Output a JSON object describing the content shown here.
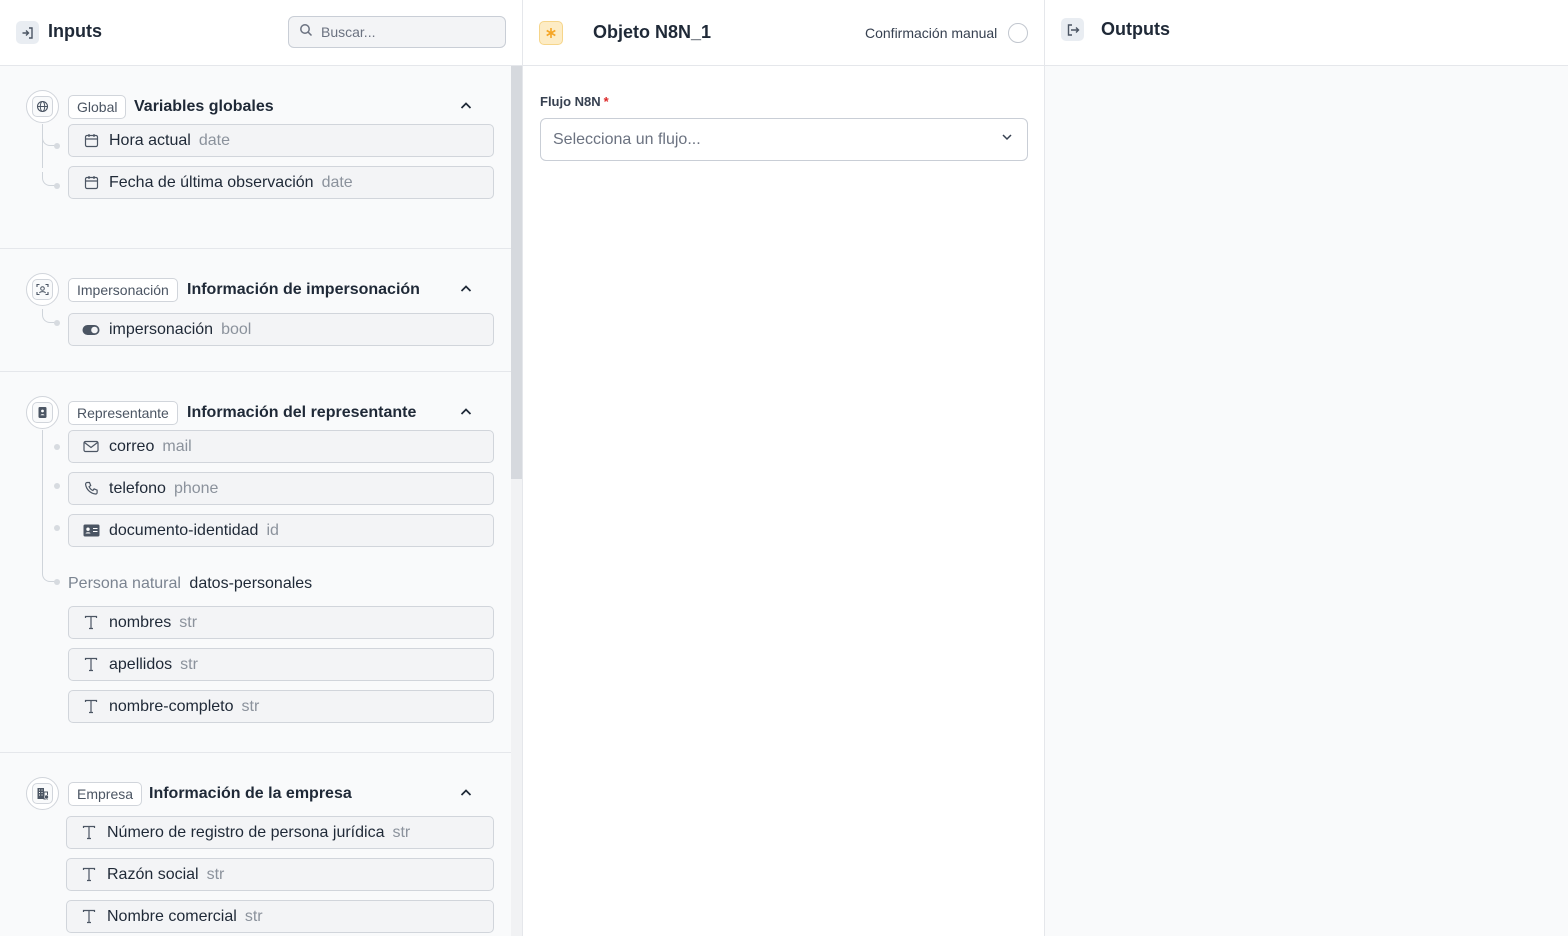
{
  "inputs_panel": {
    "title": "Inputs",
    "search_placeholder": "Buscar..."
  },
  "sections": [
    {
      "tag": "Global",
      "title": "Variables globales",
      "icon": "globe-icon",
      "fields": [
        {
          "name": "Hora actual",
          "type": "date",
          "icon": "calendar-icon"
        },
        {
          "name": "Fecha de última observación",
          "type": "date",
          "icon": "calendar-icon"
        }
      ]
    },
    {
      "tag": "Impersonación",
      "title": "Información de impersonación",
      "icon": "face-scan-icon",
      "fields": [
        {
          "name": "impersonación",
          "type": "bool",
          "icon": "toggle-icon"
        }
      ]
    },
    {
      "tag": "Representante",
      "title": "Información del representante",
      "icon": "badge-icon",
      "fields": [
        {
          "name": "correo",
          "type": "mail",
          "icon": "mail-icon"
        },
        {
          "name": "telefono",
          "type": "phone",
          "icon": "phone-icon"
        },
        {
          "name": "documento-identidad",
          "type": "id",
          "icon": "id-card-icon"
        }
      ],
      "subgroup": {
        "kind": "Persona natural",
        "name": "datos-personales",
        "fields": [
          {
            "name": "nombres",
            "type": "str",
            "icon": "text-icon"
          },
          {
            "name": "apellidos",
            "type": "str",
            "icon": "text-icon"
          },
          {
            "name": "nombre-completo",
            "type": "str",
            "icon": "text-icon"
          }
        ]
      }
    },
    {
      "tag": "Empresa",
      "title": "Información de la empresa",
      "icon": "building-icon",
      "fields": [
        {
          "name": "Número de registro de persona jurídica",
          "type": "str",
          "icon": "text-icon"
        },
        {
          "name": "Razón social",
          "type": "str",
          "icon": "text-icon"
        },
        {
          "name": "Nombre comercial",
          "type": "str",
          "icon": "text-icon"
        }
      ]
    }
  ],
  "node_panel": {
    "title": "Objeto N8N_1",
    "manual_confirm_label": "Confirmación manual",
    "manual_confirm_checked": false,
    "flow_label": "Flujo N8N",
    "required_mark": "*",
    "flow_select_placeholder": "Selecciona un flujo..."
  },
  "outputs_panel": {
    "title": "Outputs"
  },
  "colors": {
    "node_accent": "#f5a524",
    "required": "#dc2626"
  }
}
